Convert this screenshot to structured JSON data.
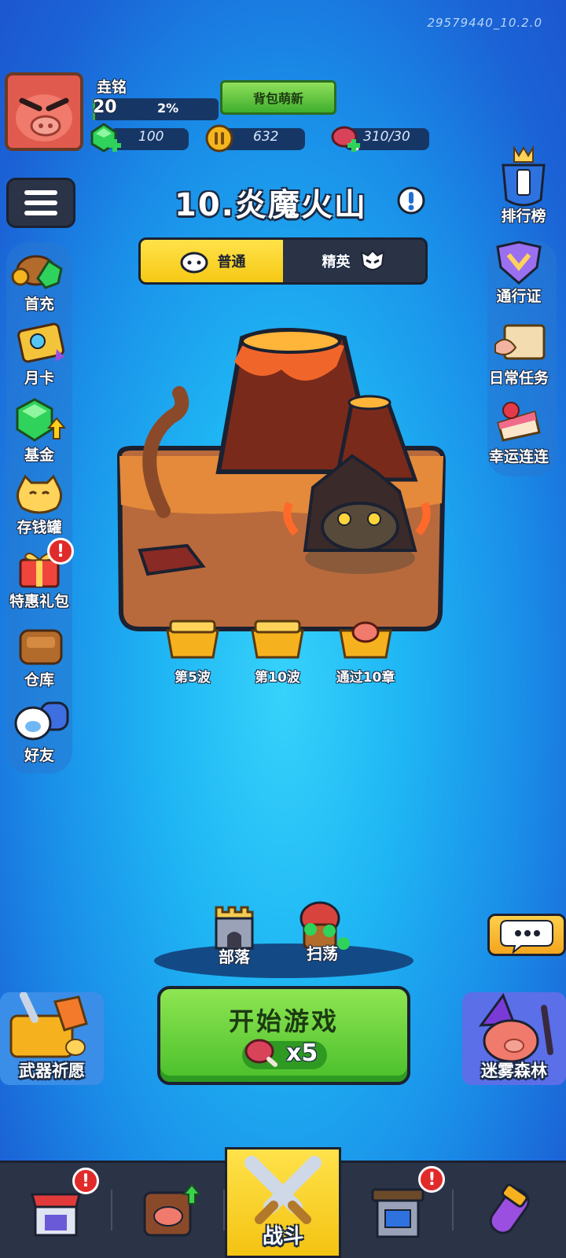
{
  "version": "29579440_10.2.0",
  "player": {
    "name": "垚铭",
    "level": "20",
    "progress_text": "2%",
    "progress": 0.02
  },
  "resources": {
    "gems": "100",
    "coins": "632",
    "energy": "310/30"
  },
  "bag_button": "背包萌新",
  "stage": {
    "title": "10.炎魔火山"
  },
  "modes": [
    {
      "label": "普通",
      "active": true
    },
    {
      "label": "精英",
      "active": false
    }
  ],
  "left_menu": [
    {
      "label": "首充",
      "icon": "gem-chest-icon"
    },
    {
      "label": "月卡",
      "icon": "monthly-card-icon"
    },
    {
      "label": "基金",
      "icon": "fund-gem-icon"
    },
    {
      "label": "存钱罐",
      "icon": "lucky-cat-icon"
    },
    {
      "label": "特惠礼包",
      "icon": "gift-box-icon"
    },
    {
      "label": "仓库",
      "icon": "backpack-icon"
    },
    {
      "label": "好友",
      "icon": "friends-icon"
    }
  ],
  "right_menu": [
    {
      "label": "排行榜",
      "icon": "trophy-icon"
    },
    {
      "label": "通行证",
      "icon": "pass-badge-icon"
    },
    {
      "label": "日常任务",
      "icon": "scroll-icon"
    },
    {
      "label": "幸运连连",
      "icon": "cake-icon"
    }
  ],
  "rewards": [
    "第5波",
    "第10波",
    "通过10章"
  ],
  "mini_buttons": {
    "tribe": "部落",
    "sweep": "扫荡"
  },
  "start": {
    "label": "开始游戏",
    "cost": "x5"
  },
  "corner": {
    "left": "武器祈愿",
    "right": "迷雾森林"
  },
  "nav": {
    "battle": "战斗",
    "badge": "!"
  },
  "colors": {
    "accent_yellow": "#f6c915",
    "green": "#49bf2b",
    "dark": "#1b2131"
  }
}
